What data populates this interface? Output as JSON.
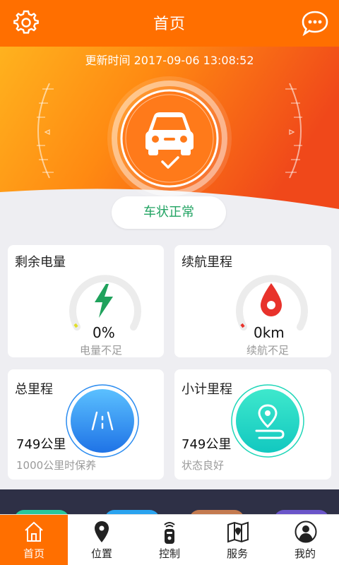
{
  "header": {
    "title": "首页",
    "left_icon": "gear-icon",
    "right_icon": "chat-bubble-icon"
  },
  "hero": {
    "update_label": "更新时间",
    "update_time": "2017-09-06 13:08:52",
    "car_icon": "car-icon",
    "status": "车状正常"
  },
  "cards": {
    "battery": {
      "label": "剩余电量",
      "value": "0%",
      "note": "电量不足",
      "icon": "lightning-icon"
    },
    "range": {
      "label": "续航里程",
      "value": "0km",
      "note": "续航不足",
      "icon": "drop-pin-icon"
    },
    "total_mileage": {
      "label": "总里程",
      "value": "749公里",
      "note": "1000公里时保养",
      "icon": "road-icon"
    },
    "trip_mileage": {
      "label": "小计里程",
      "value": "749公里",
      "note": "状态良好",
      "icon": "location-route-icon"
    }
  },
  "tabs": [
    {
      "label": "首页",
      "icon": "home-icon",
      "active": true
    },
    {
      "label": "位置",
      "icon": "location-pin-icon",
      "active": false
    },
    {
      "label": "控制",
      "icon": "remote-key-icon",
      "active": false
    },
    {
      "label": "服务",
      "icon": "map-icon",
      "active": false
    },
    {
      "label": "我的",
      "icon": "user-icon",
      "active": false
    }
  ],
  "colors": {
    "primary": "#ff6f00",
    "status_green": "#21a362",
    "battery_green": "#1fa25c",
    "range_red": "#e8322b",
    "road_blue": "#2b8cf0",
    "trip_teal": "#1ed6b8",
    "band_navy": "#2e3046"
  }
}
